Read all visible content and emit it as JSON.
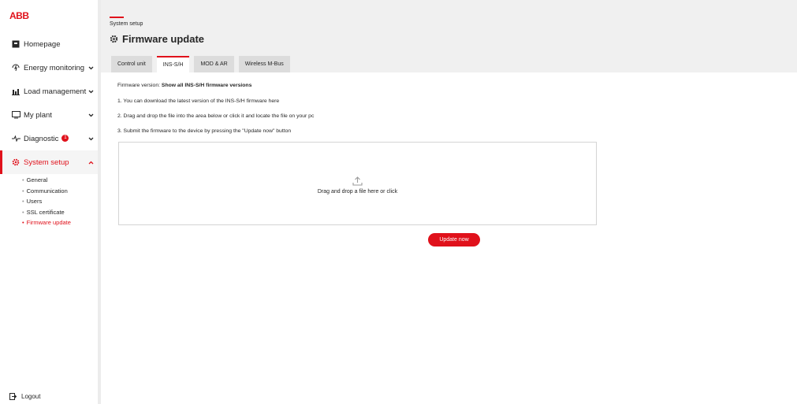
{
  "brand": {
    "logo_text": "ABB",
    "accent_color": "#e0111b"
  },
  "sidebar": {
    "items": [
      {
        "label": "Homepage",
        "icon": "home-icon"
      },
      {
        "label": "Energy monitoring",
        "icon": "energy-icon"
      },
      {
        "label": "Load management",
        "icon": "load-chart-icon"
      },
      {
        "label": "My plant",
        "icon": "monitor-icon"
      },
      {
        "label": "Diagnostic",
        "icon": "pulse-icon",
        "badge": "1"
      },
      {
        "label": "System setup",
        "icon": "gear-icon"
      }
    ],
    "sub_items": [
      {
        "label": "General"
      },
      {
        "label": "Communication"
      },
      {
        "label": "Users"
      },
      {
        "label": "SSL certificate"
      },
      {
        "label": "Firmware update"
      }
    ],
    "logout_label": "Logout"
  },
  "header": {
    "breadcrumb": "System setup",
    "title": "Firmware update",
    "tabs": [
      {
        "label": "Control unit"
      },
      {
        "label": "INS-S/H"
      },
      {
        "label": "MOD & AR"
      },
      {
        "label": "Wireless M-Bus"
      }
    ]
  },
  "main": {
    "firmware_version_label": "Firmware version:",
    "firmware_version_link": "Show all INS-S/H firmware versions",
    "step1": "1. You can download the latest version of the INS-S/H firmware here",
    "step2": "2. Drag and drop the file into the area below or click it and locate the file on your pc",
    "step3": "3. Submit the firmware to the device by pressing the \"Update now\" button",
    "dropzone_text": "Drag and drop a file here or click",
    "update_button": "Update now"
  }
}
